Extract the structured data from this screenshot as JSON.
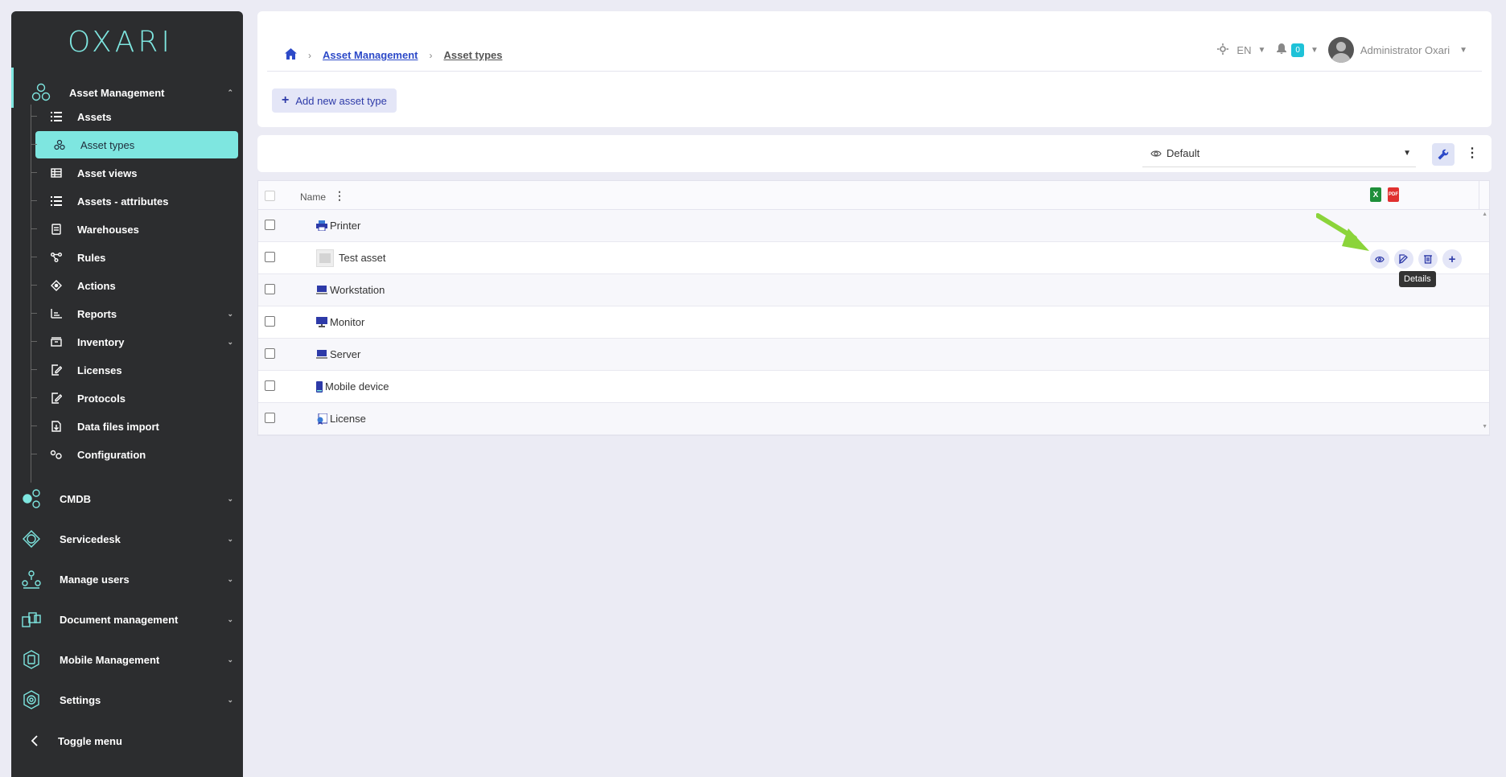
{
  "app": {
    "logo": "OXARI"
  },
  "sidebar": {
    "section": {
      "label": "Asset Management",
      "chevron": "⌃"
    },
    "items": [
      {
        "label": "Assets",
        "icon": "list-icon"
      },
      {
        "label": "Asset types",
        "icon": "asset-types-icon"
      },
      {
        "label": "Asset views",
        "icon": "table-icon"
      },
      {
        "label": "Assets - attributes",
        "icon": "list-icon"
      },
      {
        "label": "Warehouses",
        "icon": "warehouse-icon"
      },
      {
        "label": "Rules",
        "icon": "rules-icon"
      },
      {
        "label": "Actions",
        "icon": "actions-icon"
      },
      {
        "label": "Reports",
        "icon": "reports-icon"
      },
      {
        "label": "Inventory",
        "icon": "inventory-icon"
      },
      {
        "label": "Licenses",
        "icon": "licenses-icon"
      },
      {
        "label": "Protocols",
        "icon": "protocols-icon"
      },
      {
        "label": "Data files import",
        "icon": "import-icon"
      },
      {
        "label": "Configuration",
        "icon": "config-icon"
      }
    ],
    "main": [
      {
        "label": "CMDB",
        "icon": "cmdb-icon"
      },
      {
        "label": "Servicedesk",
        "icon": "servicedesk-icon"
      },
      {
        "label": "Manage users",
        "icon": "users-icon"
      },
      {
        "label": "Document management",
        "icon": "documents-icon"
      },
      {
        "label": "Mobile Management",
        "icon": "mobile-icon"
      },
      {
        "label": "Settings",
        "icon": "settings-icon"
      }
    ],
    "toggle": "Toggle menu"
  },
  "header": {
    "breadcrumb": [
      "Asset Management",
      "Asset types"
    ],
    "language": "EN",
    "notifications": "0",
    "user": "Administrator Oxari"
  },
  "toolbar": {
    "add_label": "Add new asset type",
    "view": "Default"
  },
  "table": {
    "column": "Name",
    "export": {
      "xls": "X",
      "pdf": "PDF"
    },
    "rows": [
      {
        "name": "Printer"
      },
      {
        "name": "Test asset"
      },
      {
        "name": "Workstation"
      },
      {
        "name": "Monitor"
      },
      {
        "name": "Server"
      },
      {
        "name": "Mobile device"
      },
      {
        "name": "License"
      }
    ],
    "tooltip": "Details"
  },
  "colors": {
    "accent": "#7ee6e0",
    "primary": "#2d4ac8",
    "sidebar": "#2c2d2f"
  }
}
